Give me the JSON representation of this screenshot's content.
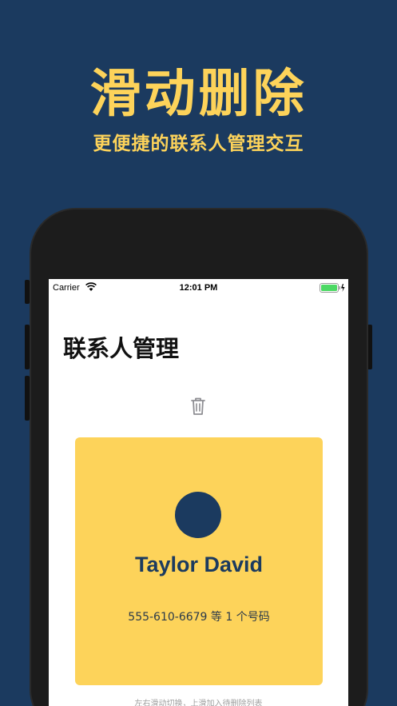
{
  "hero": {
    "title": "滑动删除",
    "subtitle": "更便捷的联系人管理交互"
  },
  "status_bar": {
    "carrier": "Carrier",
    "time": "12:01 PM",
    "wifi_icon": "wifi-icon",
    "battery_icon": "battery-icon"
  },
  "page": {
    "title": "联系人管理",
    "trash_icon": "trash-icon"
  },
  "contact": {
    "name": "Taylor David",
    "phone_summary": "555-610-6679 等 1 个号码"
  },
  "hint": "左右滑动切换，上滑加入待删除列表",
  "colors": {
    "background": "#1b3a5f",
    "accent": "#fdd35a",
    "card": "#fdd35a",
    "avatar": "#1b3a5f",
    "battery": "#4cd964"
  }
}
